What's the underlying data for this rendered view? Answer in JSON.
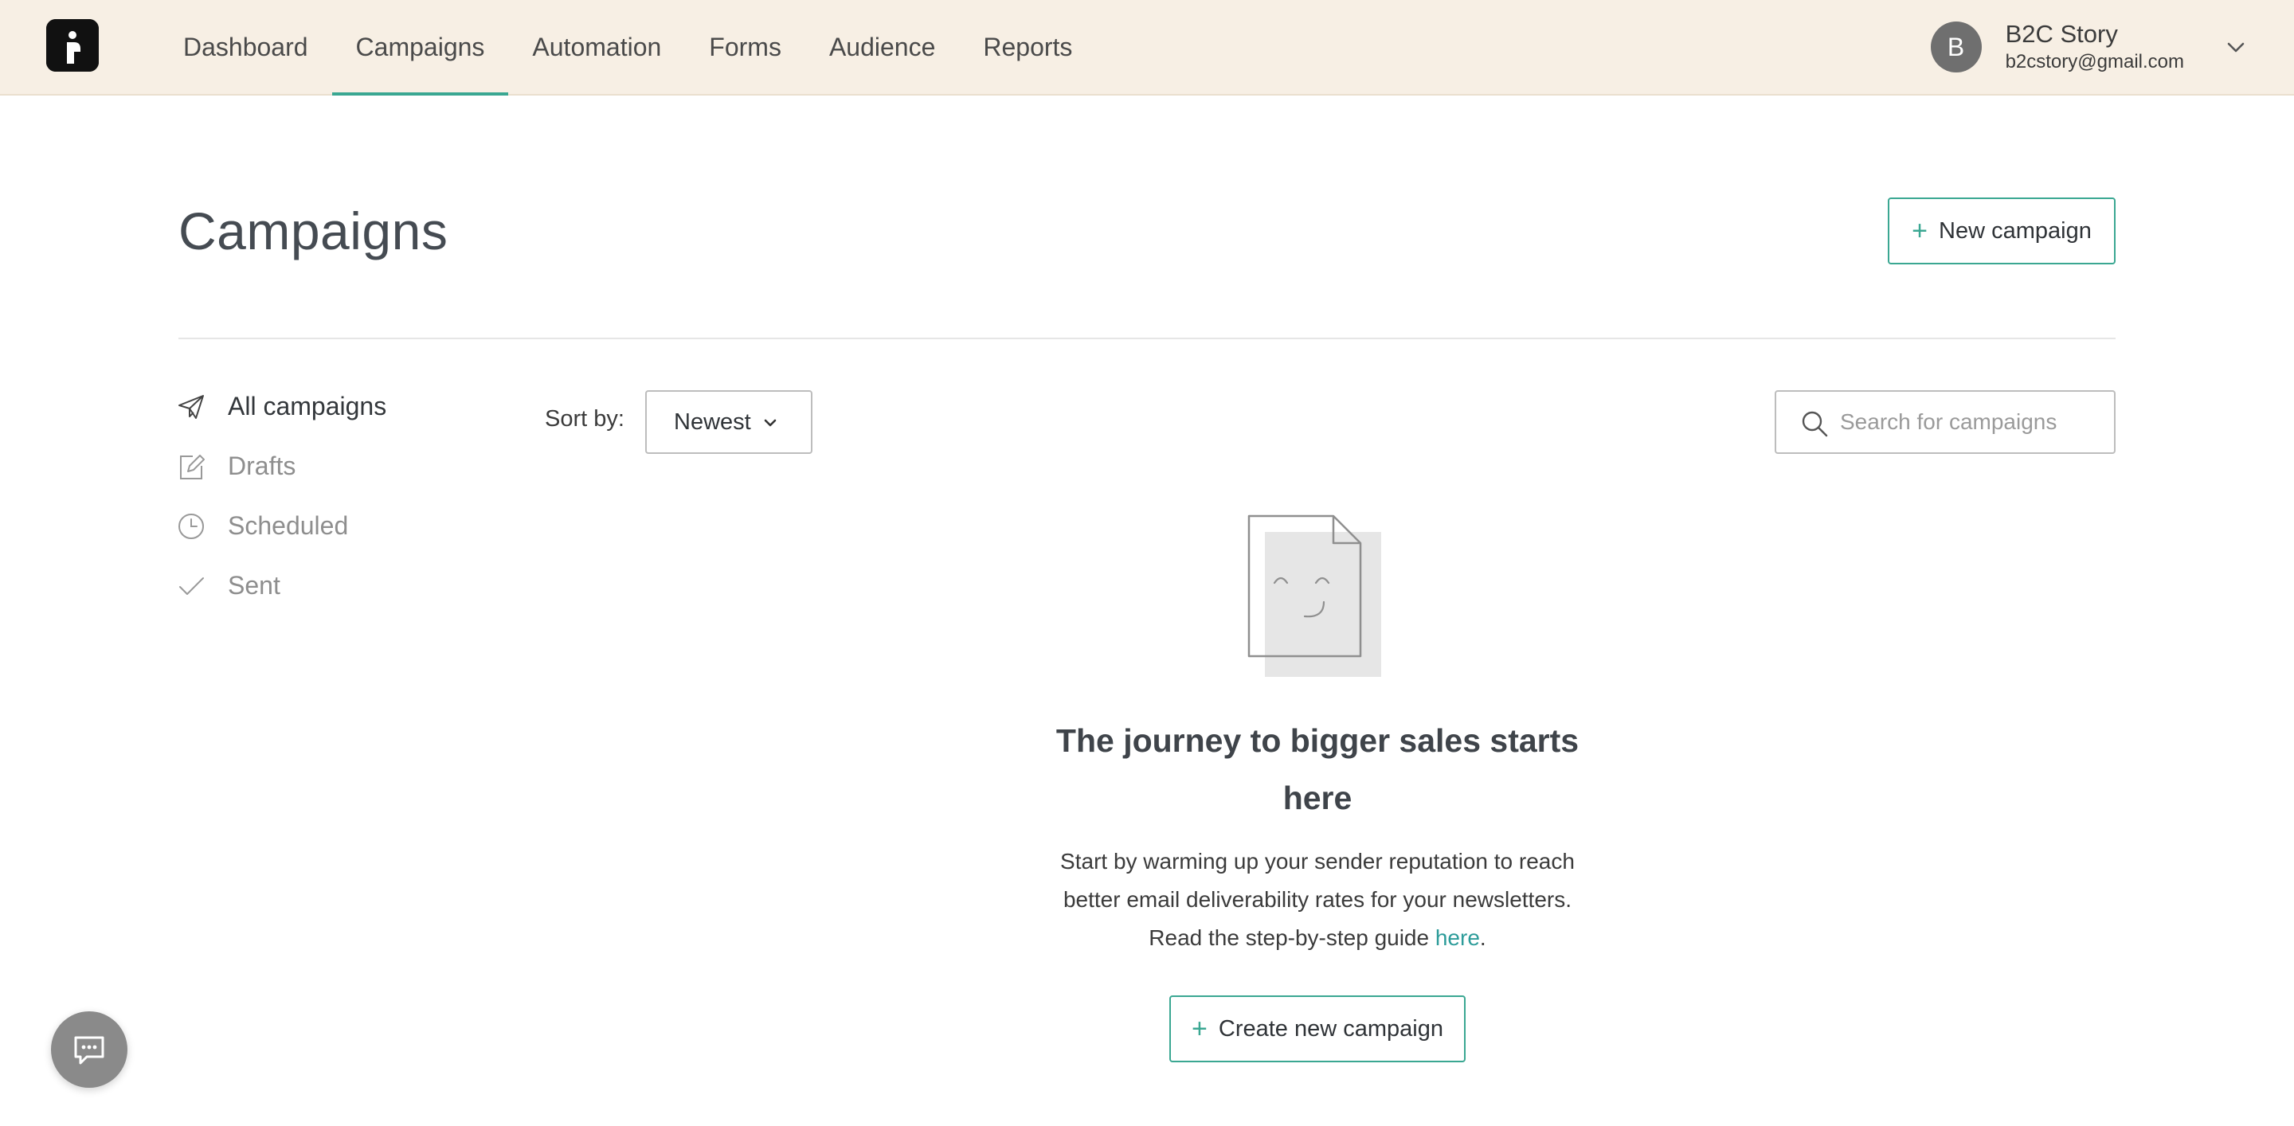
{
  "nav": {
    "items": [
      {
        "label": "Dashboard",
        "active": false
      },
      {
        "label": "Campaigns",
        "active": true
      },
      {
        "label": "Automation",
        "active": false
      },
      {
        "label": "Forms",
        "active": false
      },
      {
        "label": "Audience",
        "active": false
      },
      {
        "label": "Reports",
        "active": false
      }
    ],
    "accent_color": "#3aa792"
  },
  "account": {
    "initial": "B",
    "name": "B2C Story",
    "email": "b2cstory@gmail.com"
  },
  "page": {
    "title": "Campaigns",
    "new_campaign_label": "New campaign"
  },
  "sidebar": {
    "items": [
      {
        "label": "All campaigns",
        "icon": "paper-plane-icon",
        "active": true
      },
      {
        "label": "Drafts",
        "icon": "edit-icon",
        "active": false
      },
      {
        "label": "Scheduled",
        "icon": "clock-icon",
        "active": false
      },
      {
        "label": "Sent",
        "icon": "checkmark-icon",
        "active": false
      }
    ]
  },
  "toolbar": {
    "sort_label": "Sort by:",
    "sort_value": "Newest",
    "search_placeholder": "Search for campaigns"
  },
  "empty_state": {
    "heading": "The journey to bigger sales starts here",
    "body_line1": "Start by warming up your sender reputation to reach",
    "body_line2": "better email deliverability rates for your newsletters.",
    "body_line3_prefix": "Read the step-by-step guide ",
    "body_link": "here",
    "body_line3_suffix": ".",
    "cta_label": "Create new campaign"
  }
}
